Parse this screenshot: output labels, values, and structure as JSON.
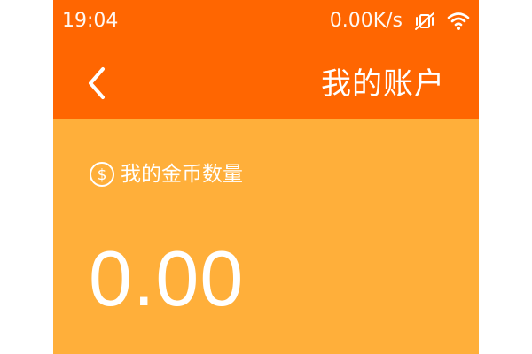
{
  "status_bar": {
    "time": "19:04",
    "network_speed": "0.00K/s",
    "icons": [
      "vibrate-off-icon",
      "wifi-icon"
    ]
  },
  "header": {
    "back_icon": "chevron-left-icon",
    "title": "我的账户"
  },
  "balance": {
    "icon": "dollar-coin-icon",
    "label": "我的金币数量",
    "amount": "0.00"
  },
  "colors": {
    "header_bg": "#FF6601",
    "card_bg": "#FFAF3A",
    "text": "#FFFFFF"
  }
}
